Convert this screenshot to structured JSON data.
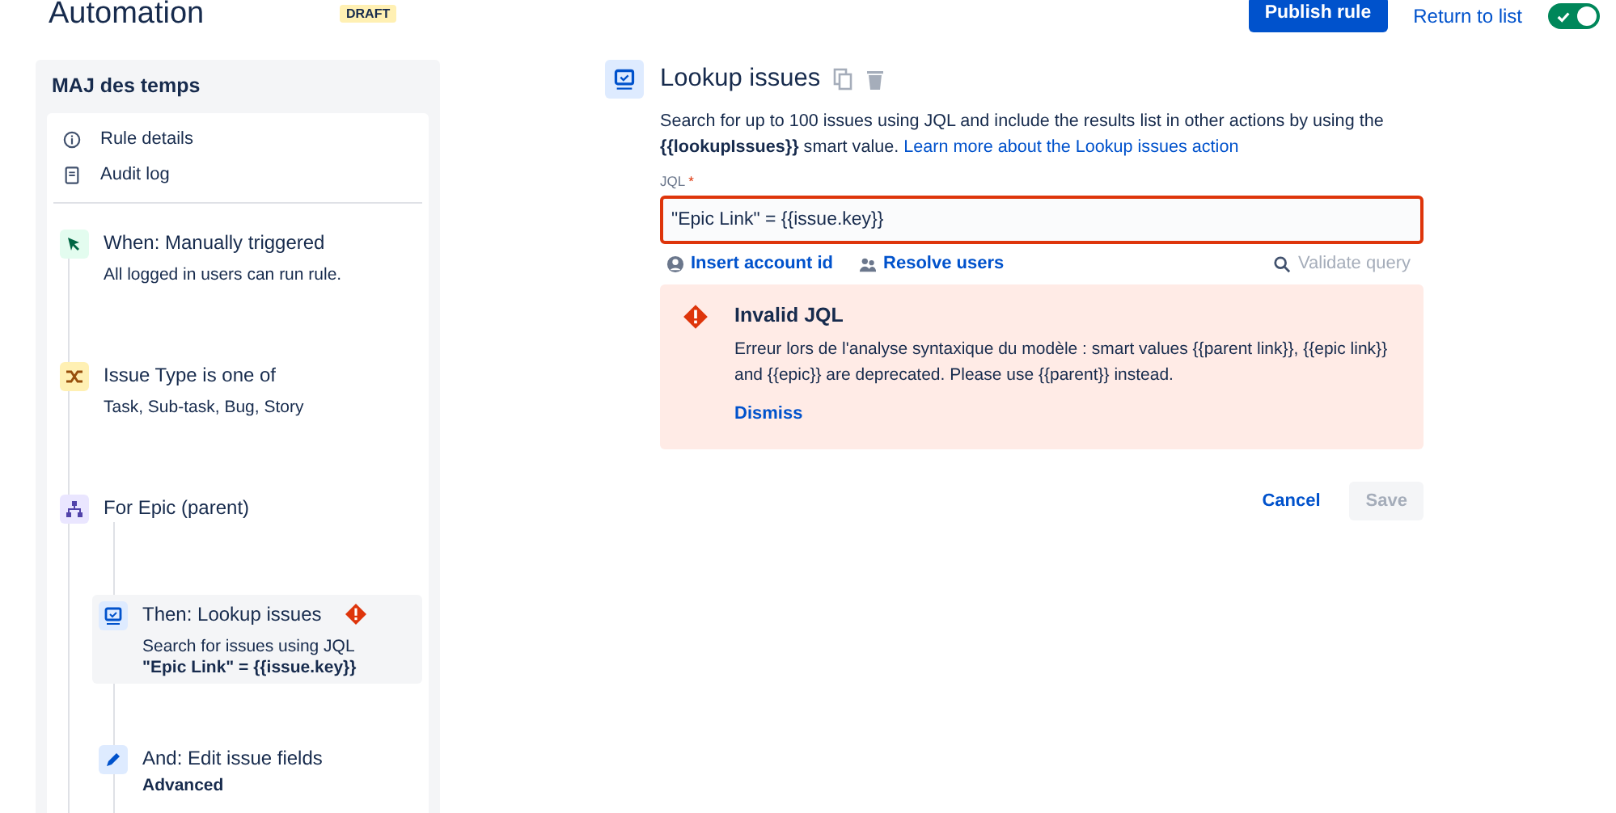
{
  "header": {
    "title": "Automation",
    "badge": "DRAFT",
    "publish_button": "Publish rule",
    "return_link": "Return to list",
    "enabled": {
      "on": true
    }
  },
  "sidebar": {
    "rule_name": "MAJ des temps",
    "links": [
      {
        "kind": "info",
        "label": "Rule details"
      },
      {
        "kind": "log",
        "label": "Audit log"
      }
    ],
    "steps": [
      {
        "kind": "trigger",
        "title": "When: Manually triggered",
        "subtitle": "All logged in users can run rule.",
        "selected": false,
        "error": false
      },
      {
        "kind": "condition",
        "title": "Issue Type is one of",
        "subtitle": "Task, Sub-task, Bug, Story",
        "selected": false,
        "error": false
      },
      {
        "kind": "branch",
        "title": "For Epic (parent)",
        "selected": false,
        "error": false,
        "children": [
          {
            "kind": "lookup",
            "title": "Then: Lookup issues",
            "subtitle": "Search for issues using JQL",
            "detail": "\"Epic Link\" = {{issue.key}}",
            "selected": true,
            "error": true
          },
          {
            "kind": "edit",
            "title": "And: Edit issue fields",
            "detail": "Advanced",
            "selected": false,
            "error": false
          }
        ]
      }
    ]
  },
  "panel": {
    "title": "Lookup issues",
    "description": "Search for up to 100 issues using JQL and include the results list in other actions by using the **{{lookupIssues}}** smart value.",
    "learn_more": "Learn more about the Lookup issues action",
    "jql": {
      "label": "JQL",
      "required_mark": "*",
      "value": "\"Epic Link\" = {{issue.key}}",
      "invalid": true
    },
    "helpers": {
      "insert_account": "Insert account id",
      "resolve_users": "Resolve users",
      "validate": "Validate query",
      "validate_disabled": true
    },
    "error": {
      "title": "Invalid JQL",
      "message": "Erreur lors de l'analyse syntaxique du modèle : smart values {{parent link}}, {{epic link}} and {{epic}} are deprecated. Please use {{parent}} instead.",
      "dismiss": "Dismiss"
    },
    "cancel": "Cancel",
    "save": {
      "label": "Save",
      "disabled": true
    }
  }
}
